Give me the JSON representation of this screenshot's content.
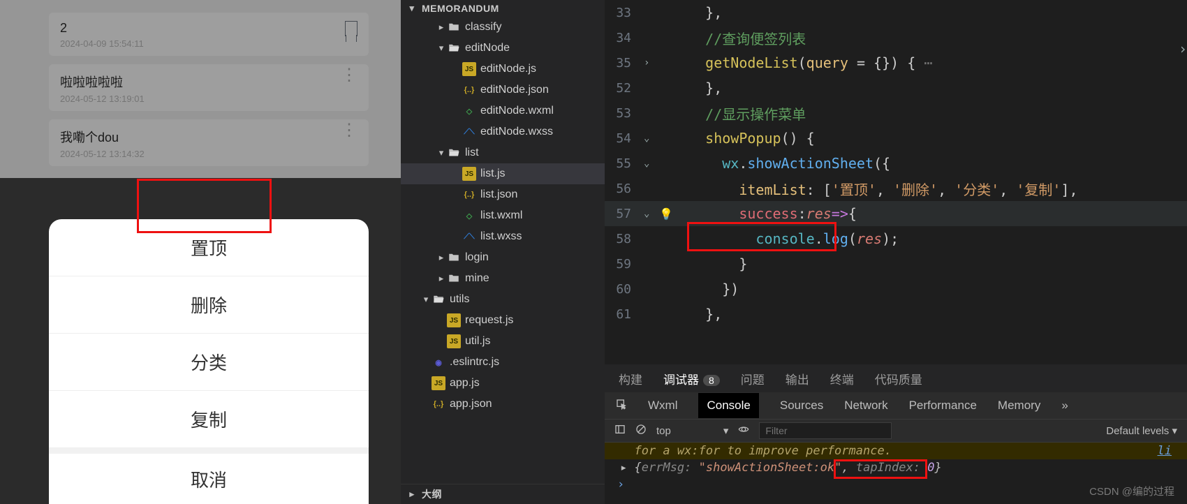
{
  "simulator": {
    "notes": [
      {
        "title": "2",
        "ts": "2024-04-09 15:54:11",
        "bookmarked": true
      },
      {
        "title": "啦啦啦啦啦",
        "ts": "2024-05-12 13:19:01",
        "bookmarked": false
      },
      {
        "title": "我嘞个dou",
        "ts": "2024-05-12 13:14:32",
        "bookmarked": false
      }
    ],
    "actionSheet": {
      "items": [
        "置顶",
        "删除",
        "分类",
        "复制"
      ],
      "cancel": "取消"
    }
  },
  "explorer": {
    "root": "MEMORANDUM",
    "tree": [
      {
        "type": "folder",
        "name": "classify",
        "depth": 1,
        "open": false
      },
      {
        "type": "folder",
        "name": "editNode",
        "depth": 1,
        "open": true
      },
      {
        "type": "file",
        "name": "editNode.js",
        "ext": "js",
        "depth": 2
      },
      {
        "type": "file",
        "name": "editNode.json",
        "ext": "json",
        "depth": 2
      },
      {
        "type": "file",
        "name": "editNode.wxml",
        "ext": "wxml",
        "depth": 2
      },
      {
        "type": "file",
        "name": "editNode.wxss",
        "ext": "wxss",
        "depth": 2
      },
      {
        "type": "folder",
        "name": "list",
        "depth": 1,
        "open": true
      },
      {
        "type": "file",
        "name": "list.js",
        "ext": "js",
        "depth": 2,
        "selected": true
      },
      {
        "type": "file",
        "name": "list.json",
        "ext": "json",
        "depth": 2
      },
      {
        "type": "file",
        "name": "list.wxml",
        "ext": "wxml",
        "depth": 2
      },
      {
        "type": "file",
        "name": "list.wxss",
        "ext": "wxss",
        "depth": 2
      },
      {
        "type": "folder",
        "name": "login",
        "depth": 1,
        "open": false
      },
      {
        "type": "folder",
        "name": "mine",
        "depth": 1,
        "open": false
      },
      {
        "type": "folder",
        "name": "utils",
        "depth": 0,
        "open": true,
        "icon": "utils"
      },
      {
        "type": "file",
        "name": "request.js",
        "ext": "js",
        "depth": 1
      },
      {
        "type": "file",
        "name": "util.js",
        "ext": "js",
        "depth": 1
      },
      {
        "type": "file",
        "name": ".eslintrc.js",
        "ext": "eslint",
        "depth": 0
      },
      {
        "type": "file",
        "name": "app.js",
        "ext": "js",
        "depth": 0
      },
      {
        "type": "file",
        "name": "app.json",
        "ext": "json",
        "depth": 0
      }
    ],
    "outline": "大纲"
  },
  "code": {
    "lines": [
      {
        "n": "33",
        "fold": "",
        "html": "<span class='c-pun'>    },</span>"
      },
      {
        "n": "34",
        "fold": "",
        "html": "    <span class='c-comment'>//查询便签列表</span>"
      },
      {
        "n": "35",
        "fold": ">",
        "html": "    <span class='c-fn'>getNodeList</span><span class='c-pun'>(</span><span class='c-ident'>query</span> <span class='c-pun'>=</span> <span class='c-pun'>{})</span> <span class='c-pun'>{</span><span class='c-gray'> ⋯</span>"
      },
      {
        "n": "52",
        "fold": "",
        "html": "<span class='c-pun'>    },</span>"
      },
      {
        "n": "53",
        "fold": "",
        "html": "    <span class='c-comment'>//显示操作菜单</span>"
      },
      {
        "n": "54",
        "fold": "v",
        "html": "    <span class='c-fn'>showPopup</span><span class='c-pun'>() {</span>"
      },
      {
        "n": "55",
        "fold": "v",
        "html": "      <span class='c-obj'>wx</span><span class='c-pun'>.</span><span class='c-prop'>showActionSheet</span><span class='c-pun'>({</span>"
      },
      {
        "n": "56",
        "fold": "",
        "html": "        <span class='c-ident'>itemList</span><span class='c-pun'>:</span> <span class='c-pun'>[</span><span class='c-str'>'置顶'</span><span class='c-pun'>, </span><span class='c-str'>'删除'</span><span class='c-pun'>, </span><span class='c-str'>'分类'</span><span class='c-pun'>, </span><span class='c-str'>'复制'</span><span class='c-pun'>],</span>"
      },
      {
        "n": "57",
        "fold": "v",
        "html": "        <span class='c-call'>success</span><span class='c-pun'>:</span><span class='c-var'>res</span><span class='c-kw'>=&gt;</span><span class='c-pun'>{</span>",
        "current": true,
        "bulb": true
      },
      {
        "n": "58",
        "fold": "",
        "html": "          <span class='c-obj'>console</span><span class='c-pun'>.</span><span class='c-prop'>log</span><span class='c-pun'>(</span><span class='c-var'>res</span><span class='c-pun'>);</span>"
      },
      {
        "n": "59",
        "fold": "",
        "html": "<span class='c-pun'>        }</span>"
      },
      {
        "n": "60",
        "fold": "",
        "html": "<span class='c-pun'>      })</span>"
      },
      {
        "n": "61",
        "fold": "",
        "html": "<span class='c-pun'>    },</span>"
      }
    ]
  },
  "panel": {
    "tabs": {
      "build": "构建",
      "debugger": "调试器",
      "badge": "8",
      "problems": "问题",
      "output": "输出",
      "terminal": "终端",
      "quality": "代码质量"
    },
    "dev": {
      "wxml": "Wxml",
      "console": "Console",
      "sources": "Sources",
      "network": "Network",
      "perf": "Performance",
      "memory": "Memory",
      "more": "»"
    },
    "ctrl": {
      "select_ctx": "top",
      "filter_ph": "Filter",
      "levels": "Default levels ▾"
    },
    "warn": "for a  wx:for  to improve performance.",
    "warn_link": "li",
    "log": {
      "toggle": "▸",
      "open": "{",
      "em": "errMsg:",
      "emv": "\"showActionSheet:ok\"",
      "sep": ", ",
      "ti": "tapIndex:",
      "tiv": "0",
      "close": "}"
    }
  },
  "watermark": "CSDN @编的过程"
}
